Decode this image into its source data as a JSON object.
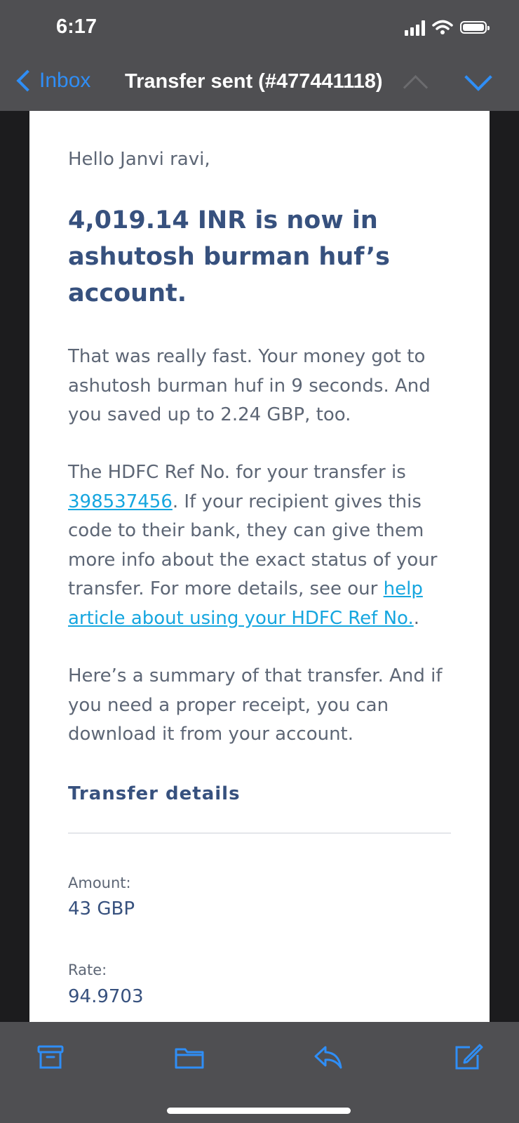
{
  "status_bar": {
    "time": "6:17"
  },
  "nav": {
    "back_label": "Inbox",
    "title": "Transfer sent (#477441118)"
  },
  "email": {
    "greeting": "Hello Janvi ravi,",
    "headline": "4,019.14 INR is now in ashutosh burman huf’s account.",
    "para1": "That was really fast. Your money got to ashutosh burman huf in 9 seconds. And you saved up to 2.24 GBP, too.",
    "para2_pre": "The HDFC Ref No. for your transfer is ",
    "ref_number": "398537456",
    "para2_mid": ". If your recipient gives this code to their bank, they can give them more info about the exact status of your transfer. For more details, see our ",
    "help_link": "help article about using your HDFC Ref No.",
    "para2_end": ".",
    "para3": "Here’s a summary of that transfer. And if you need a proper receipt, you can download it from your account.",
    "section_title": "Transfer details",
    "details": [
      {
        "label": "Amount:",
        "value": "43 GBP"
      },
      {
        "label": "Rate:",
        "value": "94.9703"
      }
    ]
  },
  "toolbar": [
    "archive-icon",
    "folder-icon",
    "reply-icon",
    "compose-icon"
  ],
  "colors": {
    "accent": "#2f8ef6",
    "heading": "#37517e",
    "link": "#16a6df",
    "bar": "#4f4f52"
  }
}
